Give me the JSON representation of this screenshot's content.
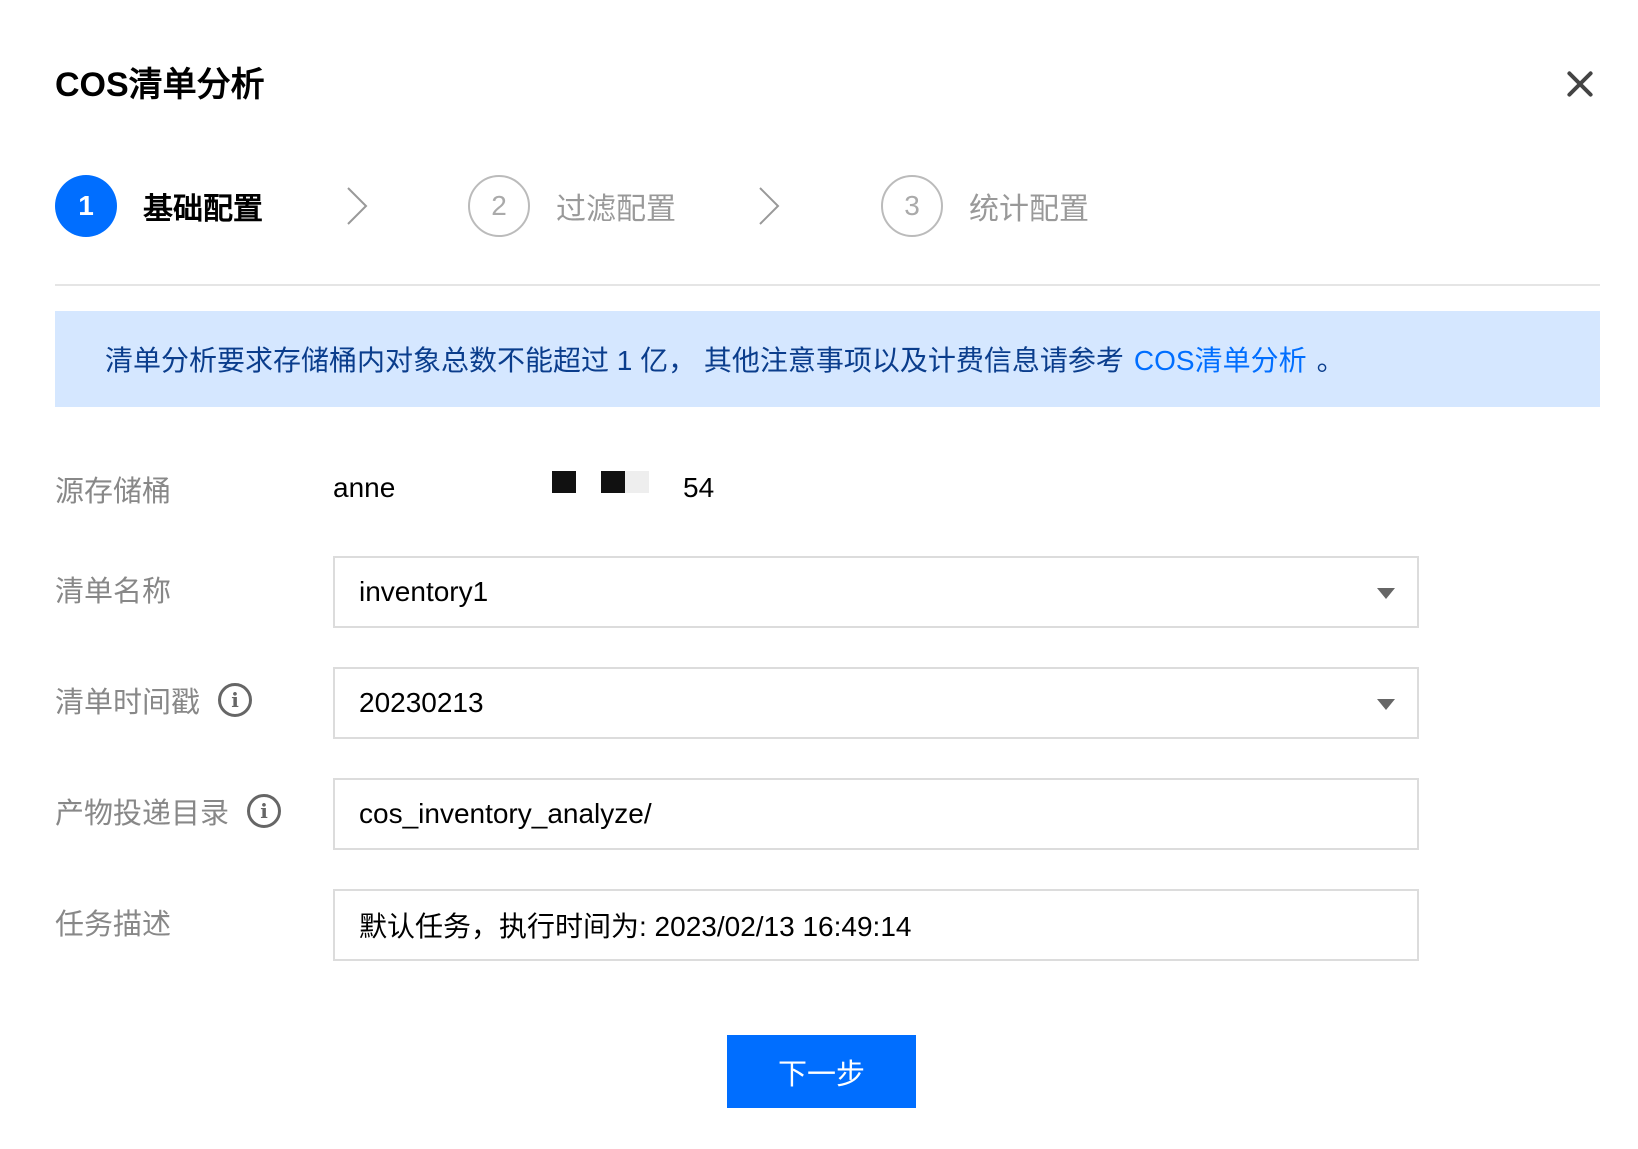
{
  "dialog": {
    "title": "COS清单分析",
    "close_icon": "close-icon"
  },
  "steps": [
    {
      "number": "1",
      "label": "基础配置",
      "state": "active"
    },
    {
      "number": "2",
      "label": "过滤配置",
      "state": "inactive"
    },
    {
      "number": "3",
      "label": "统计配置",
      "state": "inactive"
    }
  ],
  "notice": {
    "text": "清单分析要求存储桶内对象总数不能超过 1 亿， 其他注意事项以及计费信息请参考",
    "link": "COS清单分析",
    "tail": "。"
  },
  "form": {
    "source_bucket": {
      "label": "源存储桶",
      "value_start": "anne",
      "value_end": "54"
    },
    "inventory_name": {
      "label": "清单名称",
      "value": "inventory1"
    },
    "inventory_timestamp": {
      "label": "清单时间戳",
      "value": "20230213"
    },
    "output_dir": {
      "label": "产物投递目录",
      "value": "cos_inventory_analyze/"
    },
    "task_desc": {
      "label": "任务描述",
      "value": "默认任务，执行时间为: 2023/02/13 16:49:14"
    }
  },
  "footer": {
    "next_label": "下一步"
  },
  "colors": {
    "primary": "#006eff",
    "notice_bg": "#d5e7ff"
  }
}
